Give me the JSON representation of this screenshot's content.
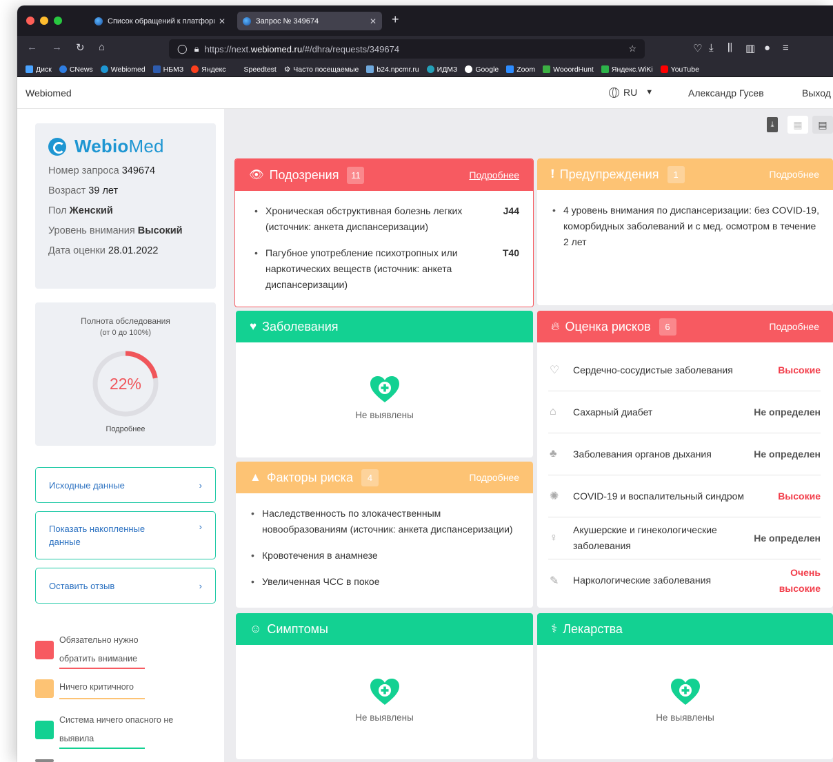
{
  "browser": {
    "tabs": [
      {
        "title": "Список обращений к платформ",
        "active": false
      },
      {
        "title": "Запрос № 349674",
        "active": true
      }
    ],
    "url_prefix": "https://next.",
    "url_host": "webiomed.ru",
    "url_path": "/#/dhra/requests/349674",
    "bookmarks": [
      "Диск",
      "CNews",
      "Webiomed",
      "НБМЗ",
      "Яндекс",
      "Speedtest",
      "Часто посещаемые",
      "b24.npcmr.ru",
      "ИДМЗ",
      "Google",
      "Zoom",
      "WooordHunt",
      "Яндекс.WiKi",
      "YouTube"
    ]
  },
  "header": {
    "brand": "Webiomed",
    "language": "RU",
    "user": "Александр Гусев",
    "logout": "Выход"
  },
  "patient": {
    "logo_a": "Webio",
    "logo_b": "Med",
    "request_label": "Номер запроса",
    "request_value": "349674",
    "age_label": "Возраст",
    "age_value": "39 лет",
    "sex_label": "Пол",
    "sex_value": "Женский",
    "attention_label": "Уровень внимания",
    "attention_value": "Высокий",
    "date_label": "Дата оценки",
    "date_value": "28.01.2022"
  },
  "completeness": {
    "title": "Полнота обследования",
    "subtitle": "(от 0 до 100%)",
    "percent_text": "22%",
    "percent": 22,
    "more": "Подробнее"
  },
  "side_buttons": {
    "initial": "Исходные данные",
    "accumulated": "Показать накопленные данные",
    "feedback": "Оставить отзыв"
  },
  "legend": [
    {
      "text": "Обязательно нужно обратить внимание",
      "color": "#f75a61"
    },
    {
      "text": "Ничего критичного",
      "color": "#fdc374"
    },
    {
      "text": "Система ничего опасного не выявила",
      "color": "#13d192"
    }
  ],
  "suspicions": {
    "title": "Подозрения",
    "count": "11",
    "more": "Подробнее",
    "items": [
      {
        "text": "Хроническая обструктивная болезнь легких (источник: анкета диспансеризации)",
        "code": "J44"
      },
      {
        "text": "Пагубное употребление психотропных или наркотических веществ (источник: анкета диспансеризации)",
        "code": "T40"
      }
    ]
  },
  "warnings": {
    "title": "Предупреждения",
    "count": "1",
    "more": "Подробнее",
    "items": [
      "4 уровень внимания по диспансеризации: без COVID-19, коморбидных заболеваний и с мед. осмотром в течение 2 лет"
    ]
  },
  "diseases": {
    "title": "Заболевания",
    "empty": "Не выявлены"
  },
  "risks": {
    "title": "Оценка рисков",
    "count": "6",
    "more": "Подробнее",
    "items": [
      {
        "name": "Сердечно-сосудистые заболевания",
        "level": "Высокие",
        "high": true
      },
      {
        "name": "Сахарный диабет",
        "level": "Не определен",
        "high": false
      },
      {
        "name": "Заболевания органов дыхания",
        "level": "Не определен",
        "high": false
      },
      {
        "name": "COVID-19 и воспалительный синдром",
        "level": "Высокие",
        "high": true
      },
      {
        "name": "Акушерские и гинекологические заболевания",
        "level": "Не определен",
        "high": false
      },
      {
        "name": "Наркологические заболевания",
        "level": "Очень высокие",
        "high": true
      }
    ]
  },
  "factors": {
    "title": "Факторы риска",
    "count": "4",
    "more": "Подробнее",
    "items": [
      "Наследственность по злокачественным новообразованиям (источник: анкета диспансеризации)",
      "Кровотечения в анамнезе",
      "Увеличенная ЧСС в покое"
    ]
  },
  "symptoms": {
    "title": "Симптомы",
    "empty": "Не выявлены"
  },
  "drugs": {
    "title": "Лекарства",
    "empty": "Не выявлены"
  },
  "colors": {
    "red": "#f75a61",
    "orange": "#fdc374",
    "green": "#13d192",
    "link": "#2b71c1"
  }
}
